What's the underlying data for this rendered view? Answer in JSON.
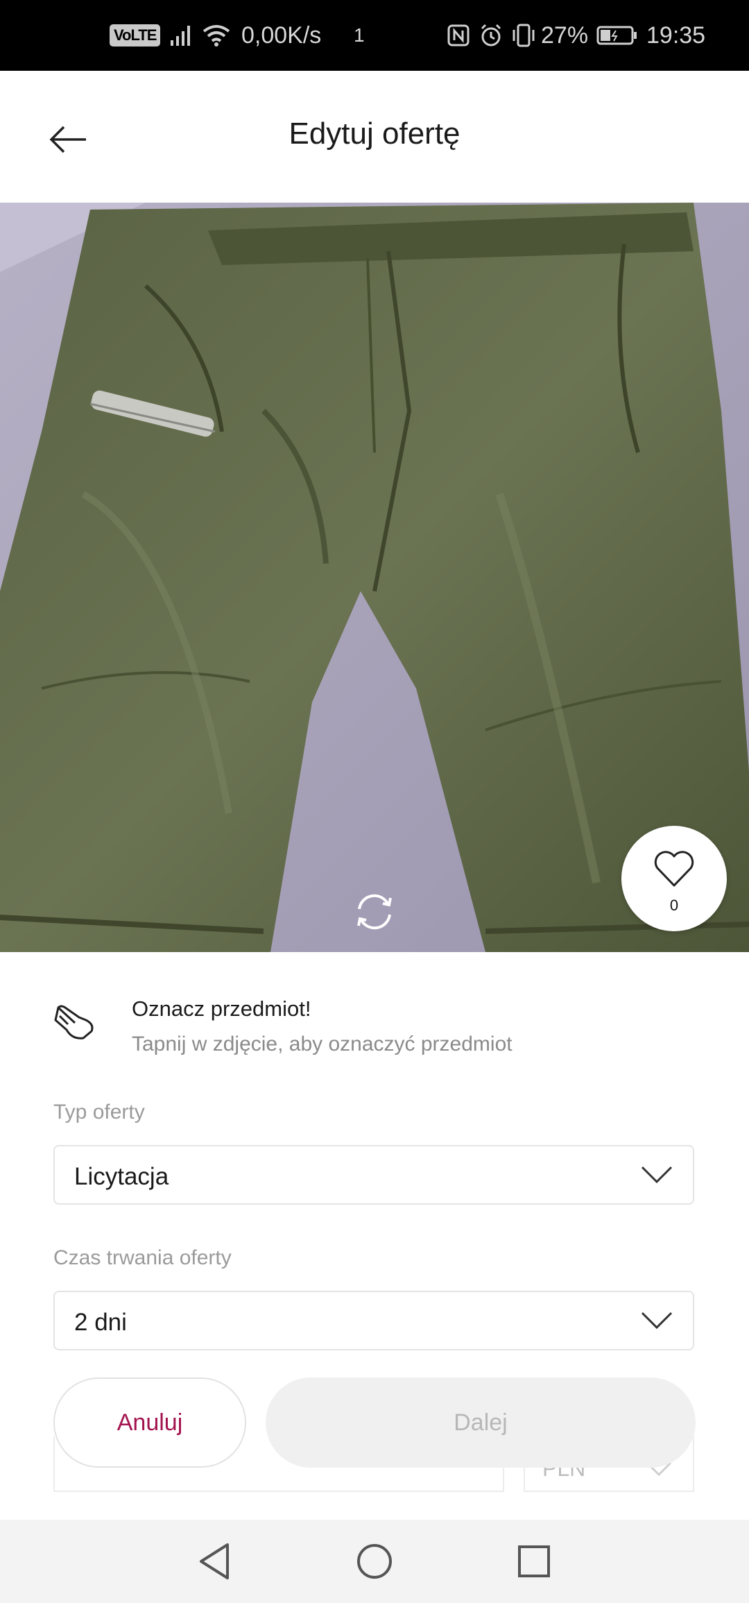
{
  "status_bar": {
    "volte": "VoLTE",
    "speed": "0,00K/s",
    "notif_count": "1",
    "battery": "27%",
    "time": "19:35"
  },
  "header": {
    "title": "Edytuj ofertę",
    "back_icon": "arrow-left-icon"
  },
  "photo": {
    "rotate_icon": "rotate-icon",
    "likes": "0",
    "like_icon": "heart-outline-icon"
  },
  "tag_hint": {
    "icon": "hand-pointer-icon",
    "title": "Oznacz przedmiot!",
    "description": "Tapnij w zdjęcie, aby oznaczyć przedmiot"
  },
  "form": {
    "offer_type": {
      "label": "Typ oferty",
      "value": "Licytacja"
    },
    "duration": {
      "label": "Czas trwania oferty",
      "value": "2 dni"
    },
    "price": {
      "currency": "PLN"
    }
  },
  "actions": {
    "cancel": "Anuluj",
    "next": "Dalej"
  },
  "colors": {
    "accent": "#a3144f",
    "disabled_bg": "#f0f0f0"
  }
}
